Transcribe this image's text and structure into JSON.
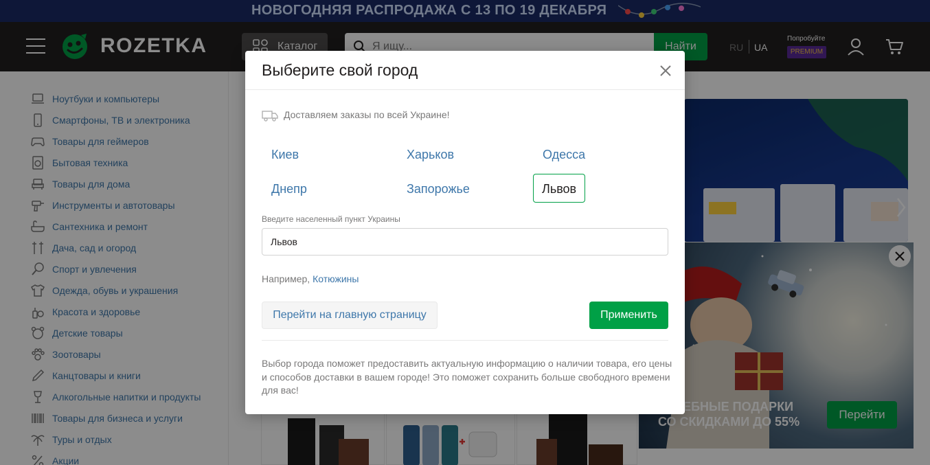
{
  "promo": {
    "text": "НОВОГОДНЯЯ РАСПРОДАЖА С 13 ПО 19 ДЕКАБРЯ"
  },
  "header": {
    "logo_text": "ROZETKA",
    "catalog_label": "Каталог",
    "search_placeholder": "Я ищу...",
    "search_button": "Найти",
    "lang_ru": "RU",
    "lang_ua": "UA",
    "premium_try": "Попробуйте",
    "premium_badge": "PREMIUM"
  },
  "sidebar": {
    "items": [
      {
        "label": "Ноутбуки и компьютеры",
        "icon": "laptop-icon"
      },
      {
        "label": "Смартфоны, ТВ и электроника",
        "icon": "smartphone-icon"
      },
      {
        "label": "Товары для геймеров",
        "icon": "gamepad-icon"
      },
      {
        "label": "Бытовая техника",
        "icon": "washing-machine-icon"
      },
      {
        "label": "Товары для дома",
        "icon": "armchair-icon"
      },
      {
        "label": "Инструменты и автотовары",
        "icon": "drill-icon"
      },
      {
        "label": "Сантехника и ремонт",
        "icon": "bathtub-icon"
      },
      {
        "label": "Дача, сад и огород",
        "icon": "garden-tools-icon"
      },
      {
        "label": "Спорт и увлечения",
        "icon": "racket-icon"
      },
      {
        "label": "Одежда, обувь и украшения",
        "icon": "tshirt-icon"
      },
      {
        "label": "Красота и здоровье",
        "icon": "cosmetics-icon"
      },
      {
        "label": "Детские товары",
        "icon": "teddy-bear-icon"
      },
      {
        "label": "Зоотовары",
        "icon": "paw-icon"
      },
      {
        "label": "Канцтовары и книги",
        "icon": "pencil-icon"
      },
      {
        "label": "Алкогольные напитки и продукты",
        "icon": "wine-glass-icon"
      },
      {
        "label": "Товары для бизнеса и услуги",
        "icon": "barcode-icon"
      },
      {
        "label": "Туры и отдых",
        "icon": "palm-tree-icon"
      },
      {
        "label": "Акции",
        "icon": "percent-icon"
      }
    ]
  },
  "gift_popup": {
    "text_line1": "…ШЕБНЫЕ ПОДАРКИ",
    "text_line2": "СО СКИДКАМИ ДО 55%",
    "button": "Перейти"
  },
  "modal": {
    "title": "Выберите свой город",
    "delivery_text": "Доставляем заказы по всей Украине!",
    "cities": [
      {
        "name": "Киев",
        "selected": false
      },
      {
        "name": "Харьков",
        "selected": false
      },
      {
        "name": "Одесса",
        "selected": false
      },
      {
        "name": "Днепр",
        "selected": false
      },
      {
        "name": "Запорожье",
        "selected": false
      },
      {
        "name": "Львов",
        "selected": true
      }
    ],
    "input_label": "Введите населенный пункт Украины",
    "input_value": "Львов",
    "example_prefix": "Например,",
    "example_city": "Котюжины",
    "home_button": "Перейти на главную страницу",
    "apply_button": "Применить",
    "info_text": "Выбор города поможет предоставить актуальную информацию о наличии товара, его цены и способов доставки в вашем городе! Это поможет сохранить больше свободного времени для вас!"
  },
  "colors": {
    "brand_green": "#00a046",
    "header_dark": "#221f1f",
    "link_blue": "#3e77aa",
    "premium_purple": "#5a2b9a"
  }
}
